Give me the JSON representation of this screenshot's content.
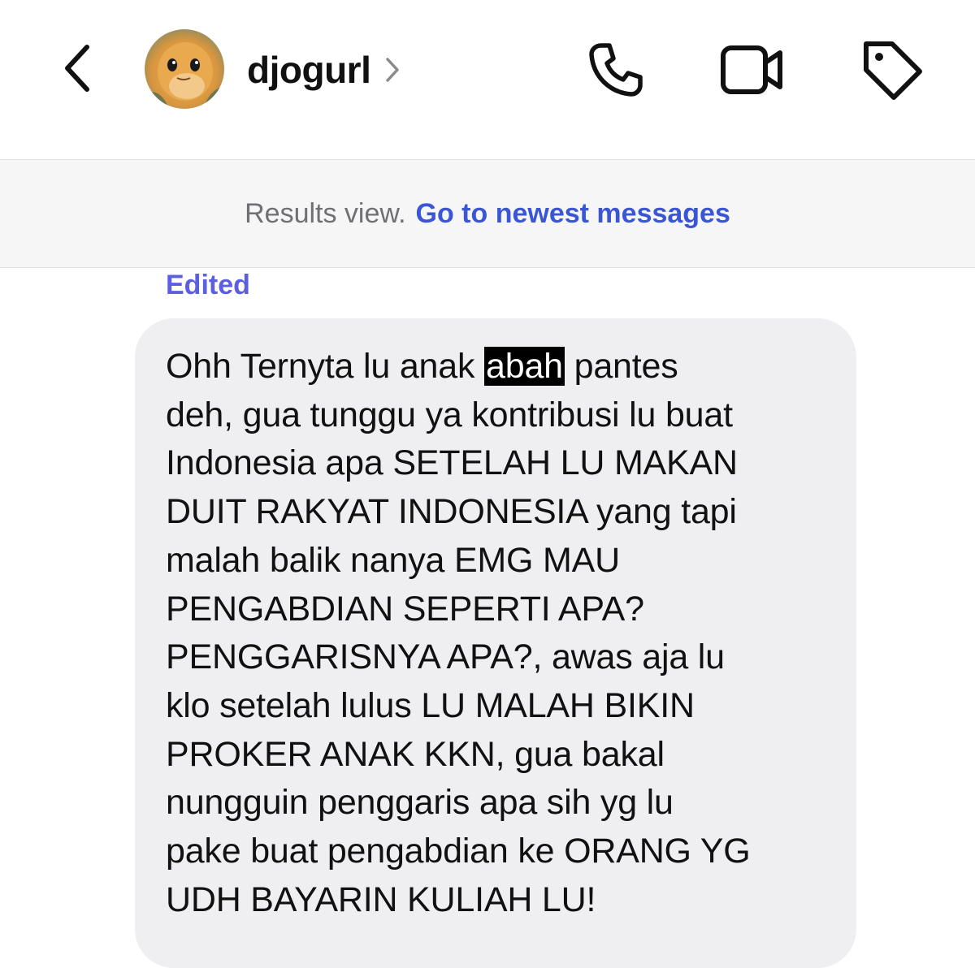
{
  "header": {
    "username": "djogurl",
    "back_icon": "chevron-left-icon",
    "username_chevron_icon": "chevron-right-icon",
    "call_icon": "phone-icon",
    "video_icon": "video-camera-icon",
    "label_icon": "tag-icon"
  },
  "banner": {
    "label": "Results view.",
    "link": "Go to newest messages"
  },
  "message": {
    "status": "Edited",
    "text_before": "Ohh Ternyta lu anak ",
    "highlighted": "abah",
    "text_after": " pantes\ndeh, gua tunggu ya kontribusi lu buat\nIndonesia apa SETELAH LU MAKAN\nDUIT RAKYAT INDONESIA yang tapi\nmalah balik nanya EMG MAU\nPENGABDIAN SEPERTI APA?\nPENGGARISNYA APA?, awas aja lu\nklo setelah lulus LU MALAH BIKIN\nPROKER ANAK KKN, gua bakal\nnungguin penggaris apa sih yg lu\npake buat pengabdian ke ORANG YG\nUDH BAYARIN KULIAH LU!"
  },
  "colors": {
    "link": "#3a56d4",
    "edited": "#5b5fe0",
    "bubble": "#efeff2",
    "banner_bg": "#f6f6f7"
  }
}
